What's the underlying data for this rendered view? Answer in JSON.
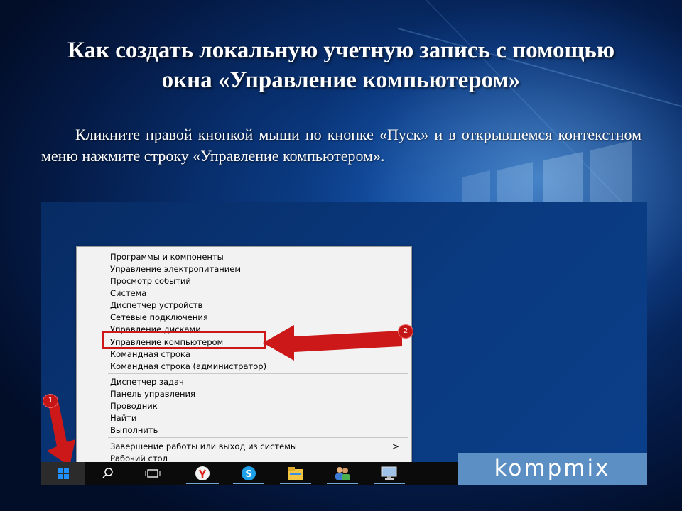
{
  "slide": {
    "title": "Как создать локальную учетную запись с помощью окна «Управление компьютером»",
    "body": "Кликните правой кнопкой мыши по кнопке «Пуск» и в открывшемся контекстном меню нажмите строку «Управление компьютером»."
  },
  "context_menu": {
    "items": [
      "Программы и компоненты",
      "Управление электропитанием",
      "Просмотр событий",
      "Система",
      "Диспетчер устройств",
      "Сетевые подключения",
      "Управление дисками",
      "Управление компьютером",
      "Командная строка",
      "Командная строка (администратор)",
      "Диспетчер задач",
      "Панель управления",
      "Проводник",
      "Найти",
      "Выполнить",
      "Завершение работы или выход из системы",
      "Рабочий стол"
    ],
    "highlighted_index": 7,
    "submenu_arrow": ">"
  },
  "annotations": {
    "badge_1": "1",
    "badge_2": "2"
  },
  "watermark": {
    "text": "kompmix"
  },
  "taskbar": {
    "icons": [
      "windows-start-icon",
      "search-icon",
      "task-view-icon",
      "yandex-browser-icon",
      "skype-icon",
      "file-explorer-icon",
      "users-icon",
      "computer-icon"
    ]
  },
  "colors": {
    "annotation_red": "#cc1818",
    "watermark_bg": "#5c8fc4",
    "start_blue": "#1e90ff"
  }
}
